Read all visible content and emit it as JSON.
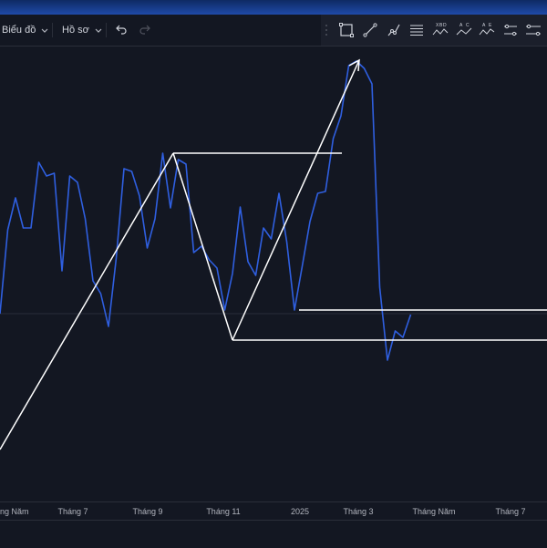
{
  "toolbar": {
    "chart_menu_label": "Biểu đồ",
    "profile_menu_label": "Hồ sơ"
  },
  "drawing_tools": {
    "icons": [
      "rectangle-icon",
      "trend-line-icon",
      "path-icon",
      "fib-lines-icon",
      "xabcd-pattern-icon",
      "abcd-pattern-icon",
      "abcde-pattern-icon",
      "parallel-channel-icon",
      "regression-icon"
    ],
    "pattern_letters": {
      "xabcd": [
        "X",
        "B",
        "D"
      ],
      "abcd": [
        "A",
        "C"
      ],
      "abcde": [
        "A",
        "E"
      ]
    }
  },
  "colors": {
    "background": "#131722",
    "price_line": "#2f5fe0",
    "drawing": "#ffffff",
    "grid": "#2a2e39",
    "text": "#b2b5be"
  },
  "x_axis": {
    "labels": [
      "Tháng Năm",
      "Tháng 7",
      "Tháng 9",
      "Tháng 11",
      "2025",
      "Tháng 3",
      "Tháng Năm",
      "Tháng 7"
    ]
  },
  "chart_data": {
    "type": "line",
    "series": [
      {
        "values": [
          344,
          252,
          217,
          250,
          250,
          178,
          193,
          190,
          297,
          193,
          200,
          240,
          308,
          322,
          358,
          283,
          185,
          188,
          215,
          272,
          240,
          168,
          228,
          175,
          180,
          277,
          270,
          285,
          294,
          340,
          300,
          227,
          287,
          302,
          250,
          262,
          212,
          265,
          340,
          292,
          243,
          212,
          210,
          152,
          127,
          72,
          67,
          75,
          92,
          315,
          395,
          363,
          370,
          345
        ]
      }
    ]
  }
}
